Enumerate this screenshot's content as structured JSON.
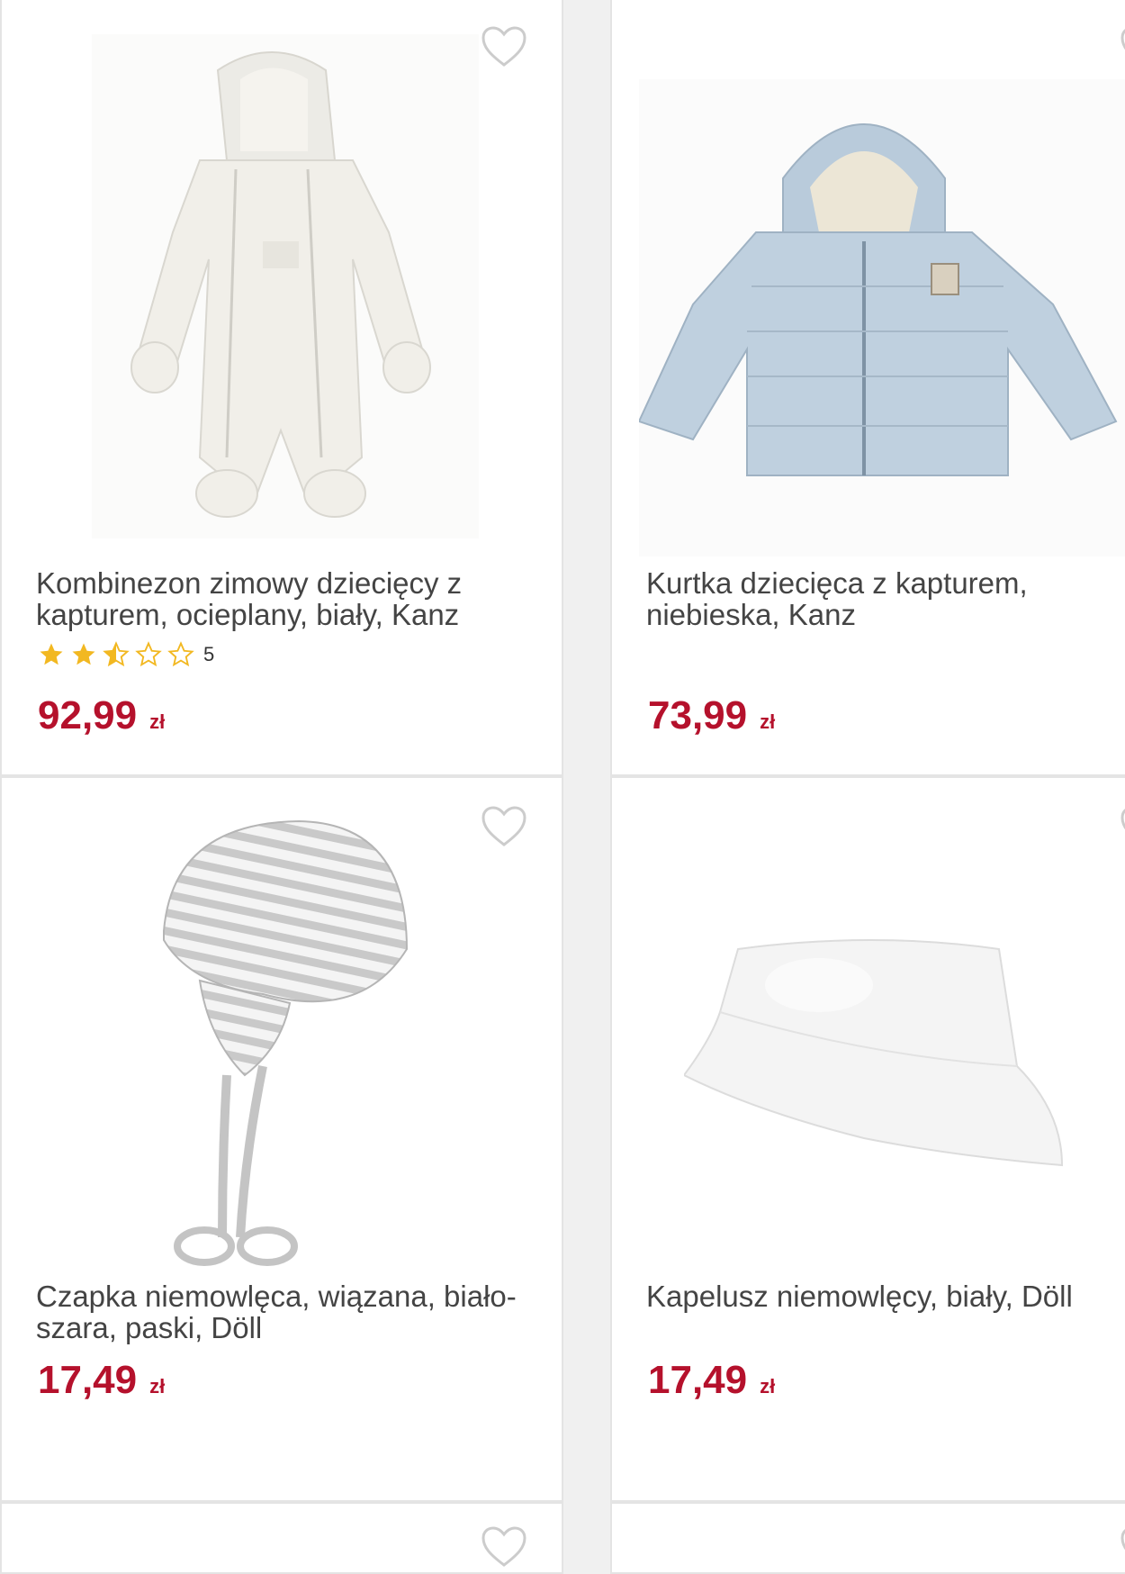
{
  "products": [
    {
      "title": "Kombinezon zimowy dziecięcy z kapturem, ocieplany, biały, Kanz",
      "price": "92,99",
      "currency": "zł",
      "rating": 2.5,
      "rating_max": 5,
      "review_count": "5",
      "image_icon": "white-snowsuit-image"
    },
    {
      "title": "Kurtka dziecięca z kapturem, niebieska, Kanz",
      "price": "73,99",
      "currency": "zł",
      "image_icon": "blue-puffer-jacket-image"
    },
    {
      "title": "Czapka niemowlęca, wiązana, biało-szara, paski, Döll",
      "price": "17,49",
      "currency": "zł",
      "image_icon": "striped-baby-hat-image"
    },
    {
      "title": "Kapelusz niemowlęcy, biały, Döll",
      "price": "17,49",
      "currency": "zł",
      "image_icon": "white-bucket-hat-image"
    }
  ],
  "colors": {
    "price": "#b5112c",
    "star": "#f2b821",
    "heart": "#cccccc"
  }
}
